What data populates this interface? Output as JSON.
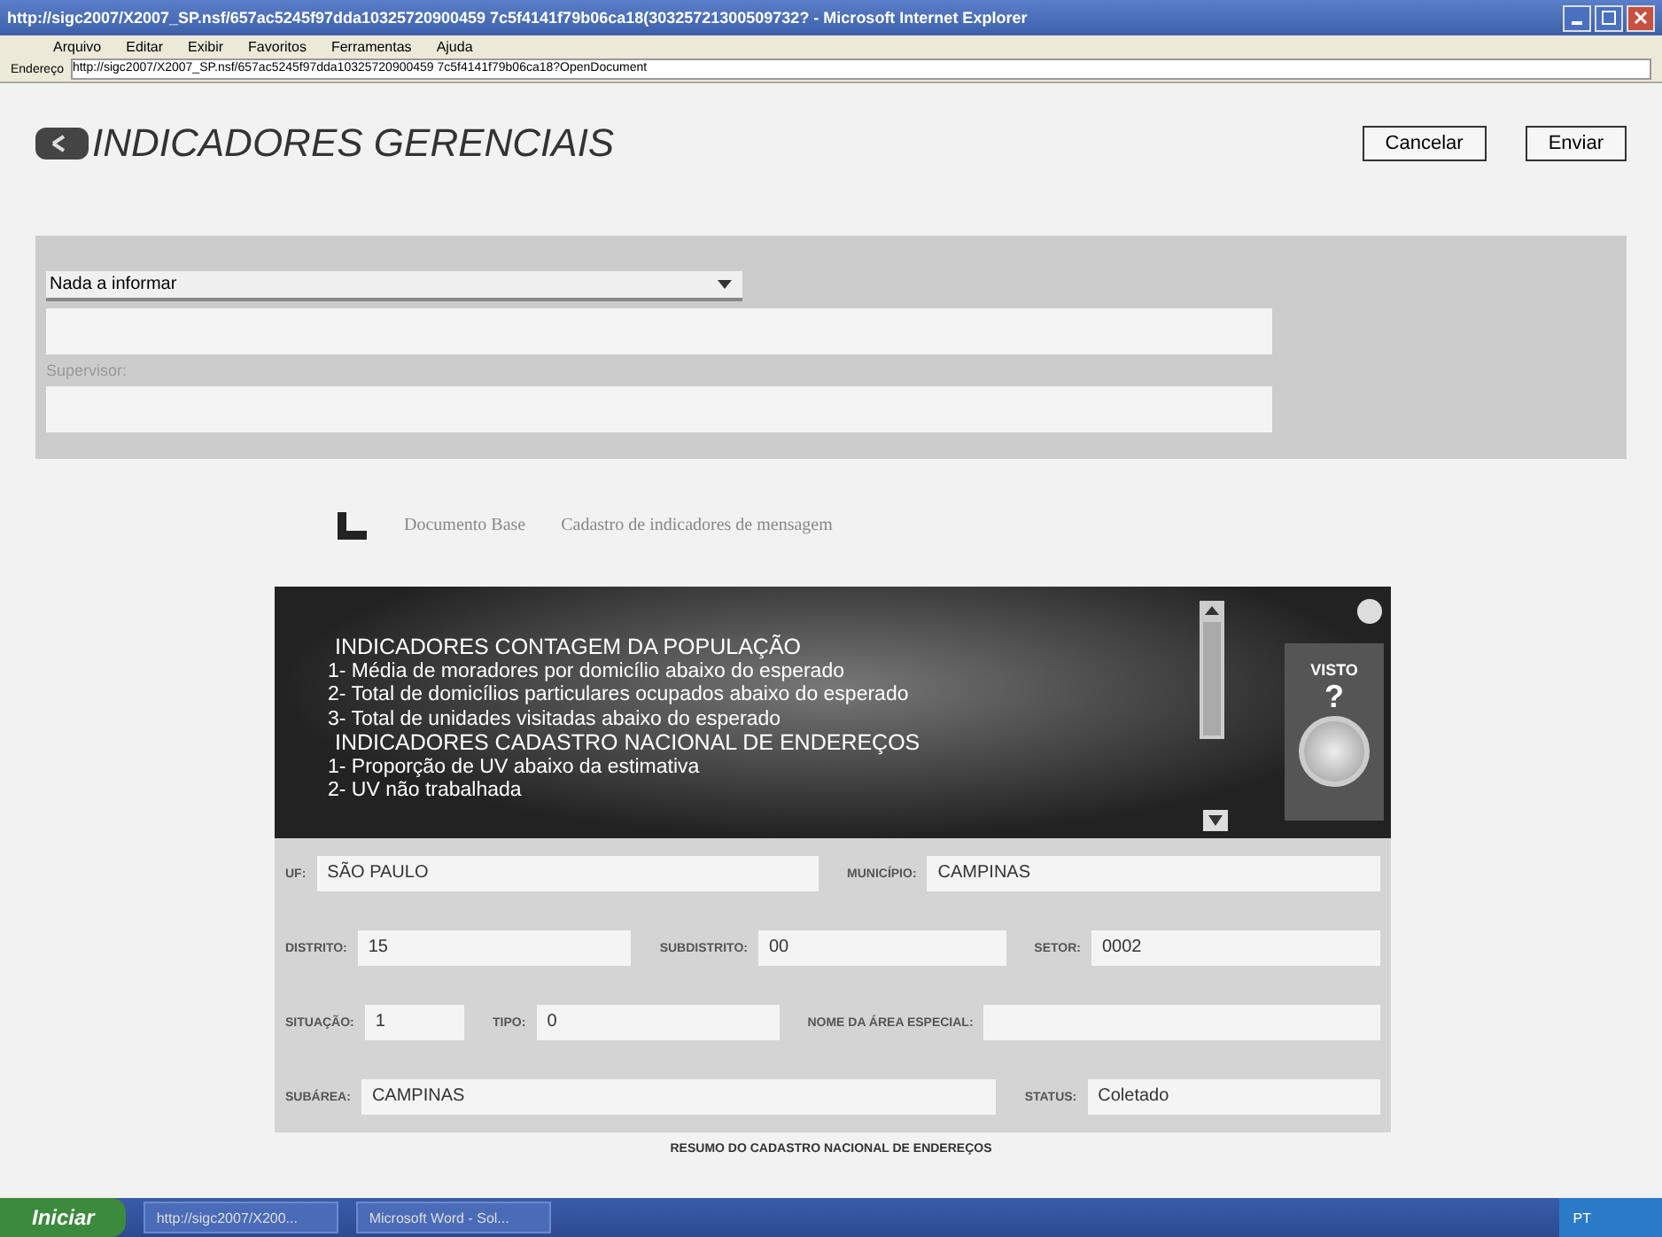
{
  "window": {
    "title": "http://sigc2007/X2007_SP.nsf/657ac5245f97dda10325720900459 7c5f4141f79b06ca18(30325721300509732? - Microsoft Internet Explorer"
  },
  "menu": [
    "Arquivo",
    "Editar",
    "Exibir",
    "Favoritos",
    "Ferramentas",
    "Ajuda"
  ],
  "address": {
    "label": "Endereço",
    "value": "http://sigc2007/X2007_SP.nsf/657ac5245f97dda10325720900459 7c5f4141f79b06ca18?OpenDocument"
  },
  "header": {
    "title": "INDICADORES GERENCIAIS",
    "buttons": [
      "Cancelar",
      "Enviar"
    ]
  },
  "form_top": {
    "select_value": "Nada a informar",
    "supervisor_label": "Supervisor:"
  },
  "links": [
    "Documento Base",
    "Cadastro de indicadores de mensagem"
  ],
  "indicator_panel": {
    "lines": [
      {
        "kind": "heading",
        "text": "INDICADORES CONTAGEM DA POPULAÇÃO"
      },
      {
        "kind": "item",
        "text": "1- Média de moradores por domicílio abaixo do esperado"
      },
      {
        "kind": "item",
        "text": "2- Total de domicílios particulares ocupados abaixo do esperado"
      },
      {
        "kind": "item",
        "text": "3- Total de unidades visitadas abaixo do esperado"
      },
      {
        "kind": "heading",
        "text": "INDICADORES CADASTRO NACIONAL DE ENDEREÇOS"
      },
      {
        "kind": "item",
        "text": "1- Proporção de UV abaixo da estimativa"
      },
      {
        "kind": "item",
        "text": "2- UV não trabalhada"
      }
    ],
    "visto_label": "VISTO",
    "help": "?"
  },
  "fields": [
    [
      {
        "label": "UF:",
        "value": "SÃO PAULO"
      },
      {
        "label": "MUNICÍPIO:",
        "value": "CAMPINAS"
      }
    ],
    [
      {
        "label": "DISTRITO:",
        "value": "15"
      },
      {
        "label": "SUBDISTRITO:",
        "value": "00"
      },
      {
        "label": "SETOR:",
        "value": "0002"
      }
    ],
    [
      {
        "label": "SITUAÇÃO:",
        "value": "1"
      },
      {
        "label": "TIPO:",
        "value": "0"
      },
      {
        "label": "NOME DA ÁREA ESPECIAL:"
      }
    ],
    [
      {
        "label": "SUBÁREA:",
        "value": "CAMPINAS"
      },
      {
        "label": "STATUS:",
        "value": "Coletado"
      }
    ]
  ],
  "footer": "RESUMO DO CADASTRO NACIONAL DE ENDEREÇOS",
  "taskbar": {
    "start": "Iniciar",
    "tasks": [
      "http://sigc2007/X200...",
      "Microsoft Word - Sol..."
    ],
    "clock": "PT"
  }
}
